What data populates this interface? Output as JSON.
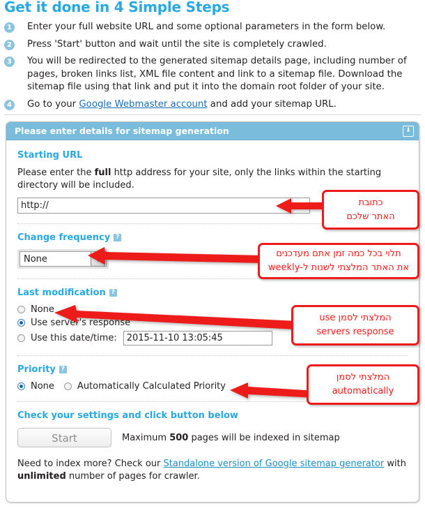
{
  "heading": "Get it done in 4 Simple Steps",
  "steps": [
    {
      "num": "1",
      "text": "Enter your full website URL and some optional parameters in the form below."
    },
    {
      "num": "2",
      "text": "Press 'Start' button and wait until the site is completely crawled."
    },
    {
      "num": "3",
      "text": "You will be redirected to the generated sitemap details page, including number of pages, broken links list, XML file content and link to a sitemap file. Download the sitemap file using that link and put it into the domain root folder of your site."
    },
    {
      "num": "4",
      "text_before": "Go to your ",
      "link": "Google Webmaster account",
      "text_after": " and add your sitemap URL."
    }
  ],
  "panel": {
    "title": "Please enter details for sitemap generation",
    "collapse_icon": "download-arrow-icon",
    "starting_url": {
      "label": "Starting URL",
      "desc_before": "Please enter the ",
      "desc_bold": "full",
      "desc_after": " http address for your site, only the links within the starting directory will be included.",
      "value": "http://"
    },
    "change_frequency": {
      "label": "Change frequency",
      "help": "?",
      "selected": "None"
    },
    "last_modification": {
      "label": "Last modification",
      "help": "?",
      "options": [
        {
          "label": "None",
          "selected": false
        },
        {
          "label": "Use server's response",
          "selected": true
        },
        {
          "label": "Use this date/time:",
          "selected": false
        }
      ],
      "datetime_value": "2015-11-10 13:05:45"
    },
    "priority": {
      "label": "Priority",
      "help": "?",
      "options": [
        {
          "label": "None",
          "selected": true
        },
        {
          "label": "Automatically Calculated Priority",
          "selected": false
        }
      ]
    },
    "submit": {
      "label": "Check your settings and click button below",
      "button": "Start",
      "max_before": "Maximum ",
      "max_bold": "500",
      "max_after": " pages will be indexed in sitemap"
    },
    "footer": {
      "before": "Need to index more? Check our ",
      "link": "Standalone version of Google sitemap generator",
      "mid": " with ",
      "bold": "unlimited",
      "after": " number of pages for crawler."
    }
  },
  "annotations": [
    {
      "id": "url",
      "line1": "כתובת",
      "line2": "האתר שלכם"
    },
    {
      "id": "frequency",
      "line1": "תלוי בכל כמה זמן אתם מעדכנים",
      "line2": "את האתר המלצתי לשנות ל-weekly"
    },
    {
      "id": "lastmod",
      "line1": "המלצתי לסמן  use",
      "line2": "servers response"
    },
    {
      "id": "priority",
      "line1": "המלצתי לסמן",
      "line2": "automatically"
    }
  ],
  "colors": {
    "accent_blue": "#29a9e0",
    "panel_header": "#79bcdb",
    "badge_blue": "#8cc3de",
    "annotation_red": "#ee1b1b",
    "link_blue": "#1a8fc1"
  }
}
